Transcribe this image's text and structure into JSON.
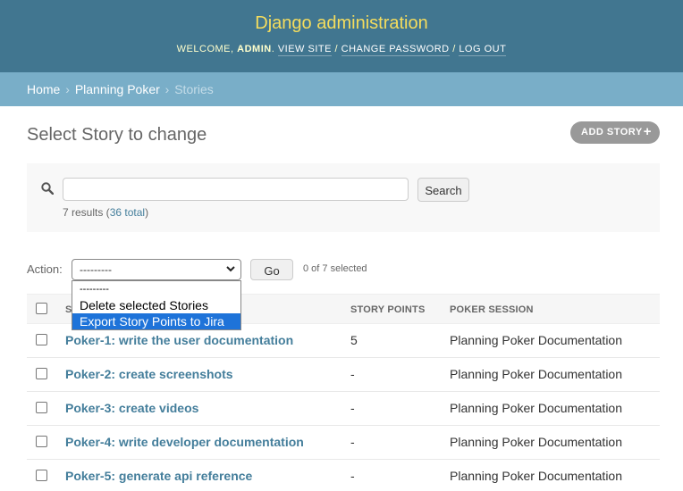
{
  "header": {
    "site_name": "Django administration",
    "welcome": "Welcome,",
    "username": "admin",
    "view_site": "View site",
    "change_password": "Change password",
    "log_out": "Log out",
    "separator": "/"
  },
  "breadcrumbs": {
    "home": "Home",
    "app": "Planning Poker",
    "current": "Stories",
    "separator": "›"
  },
  "page": {
    "title": "Select Story to change",
    "add_button": "Add Story",
    "add_icon": "+"
  },
  "search": {
    "query": "",
    "button": "Search",
    "results_prefix": "7 results (",
    "total_link": "36 total",
    "results_suffix": ")"
  },
  "actions": {
    "label": "Action:",
    "selected_value": "---------",
    "go_button": "Go",
    "selected_count": "0 of 7 selected",
    "options": [
      {
        "label": "---------",
        "highlighted": false
      },
      {
        "label": "Delete selected Stories",
        "highlighted": false
      },
      {
        "label": "Export Story Points to Jira",
        "highlighted": true
      }
    ]
  },
  "table": {
    "columns": [
      "Story",
      "Story points",
      "Poker session"
    ],
    "rows": [
      {
        "title": "Poker-1: write the user documentation",
        "story_points": "5",
        "poker_session": "Planning Poker Documentation"
      },
      {
        "title": "Poker-2: create screenshots",
        "story_points": "-",
        "poker_session": "Planning Poker Documentation"
      },
      {
        "title": "Poker-3: create videos",
        "story_points": "-",
        "poker_session": "Planning Poker Documentation"
      },
      {
        "title": "Poker-4: write developer documentation",
        "story_points": "-",
        "poker_session": "Planning Poker Documentation"
      },
      {
        "title": "Poker-5: generate api reference",
        "story_points": "-",
        "poker_session": "Planning Poker Documentation"
      }
    ]
  },
  "colors": {
    "header_bg": "#417690",
    "breadcrumb_bg": "#79aec8",
    "site_name": "#f5dd5d",
    "link": "#447e9b",
    "option_highlight": "#1e73d9"
  },
  "icons": {
    "search": "search-icon",
    "select_arrow": "chevron-down-icon",
    "add": "plus-icon"
  }
}
